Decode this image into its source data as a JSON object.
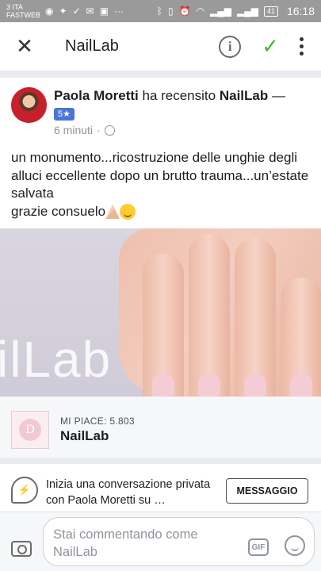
{
  "status_bar": {
    "carrier_line1": "3 ITA",
    "carrier_line2": "FASTWEB",
    "battery": "41",
    "time": "16:18"
  },
  "header": {
    "title": "NailLab"
  },
  "post": {
    "author": "Paola Moretti",
    "action": "ha recensito",
    "page": "NailLab",
    "dash": "—",
    "rating": "5★",
    "time": "6 minuti",
    "separator": "·",
    "text": "un monumento...ricostruzione delle unghie degli alluci eccellente dopo un brutto trauma...un’estate salvata\ngrazie consuelo",
    "image_watermark": "ilLab"
  },
  "page_card": {
    "likes": "MI PIACE: 5.803",
    "name": "NailLab"
  },
  "messenger": {
    "text": "Inizia una conversazione privata con Paola Moretti su …",
    "button_label": "MESSAGGIO"
  },
  "comment": {
    "placeholder": "Stai commentando come NailLab",
    "gif_label": "GIF"
  }
}
